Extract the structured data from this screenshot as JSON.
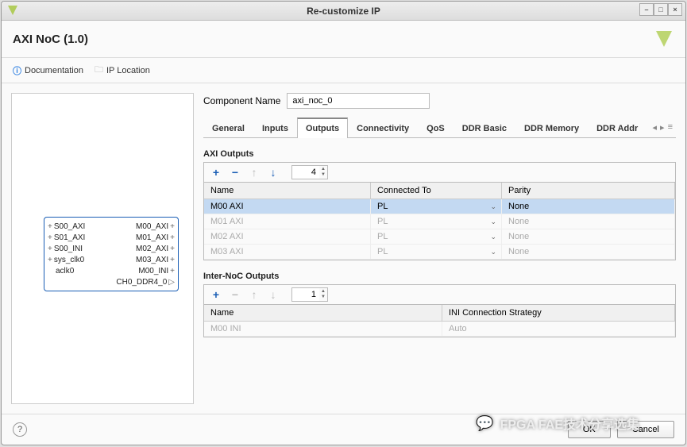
{
  "window": {
    "title": "Re-customize IP"
  },
  "header": {
    "title": "AXI NoC (1.0)"
  },
  "toolbar": {
    "documentation": "Documentation",
    "iplocation": "IP Location"
  },
  "component": {
    "label": "Component Name",
    "value": "axi_noc_0"
  },
  "tabs": {
    "items": [
      "General",
      "Inputs",
      "Outputs",
      "Connectivity",
      "QoS",
      "DDR Basic",
      "DDR Memory",
      "DDR Addr"
    ],
    "active": 2
  },
  "axi_outputs": {
    "title": "AXI Outputs",
    "count": "4",
    "headers": {
      "name": "Name",
      "connected": "Connected To",
      "parity": "Parity"
    },
    "rows": [
      {
        "name": "M00 AXI",
        "connected": "PL",
        "parity": "None",
        "sel": true
      },
      {
        "name": "M01 AXI",
        "connected": "PL",
        "parity": "None",
        "dis": true
      },
      {
        "name": "M02 AXI",
        "connected": "PL",
        "parity": "None",
        "dis": true
      },
      {
        "name": "M03 AXI",
        "connected": "PL",
        "parity": "None",
        "dis": true
      }
    ]
  },
  "inter_noc": {
    "title": "Inter-NoC Outputs",
    "count": "1",
    "headers": {
      "name": "Name",
      "strategy": "INI Connection Strategy"
    },
    "rows": [
      {
        "name": "M00 INI",
        "strategy": "Auto",
        "dis": true
      }
    ]
  },
  "ipblock": {
    "left": [
      "S00_AXI",
      "S01_AXI",
      "S00_INI",
      "sys_clk0",
      "aclk0"
    ],
    "right": [
      "M00_AXI",
      "M01_AXI",
      "M02_AXI",
      "M03_AXI",
      "M00_INI",
      "CH0_DDR4_0"
    ]
  },
  "footer": {
    "ok": "OK",
    "cancel": "Cancel"
  },
  "watermark": "FPGA FAE技术分享选集"
}
